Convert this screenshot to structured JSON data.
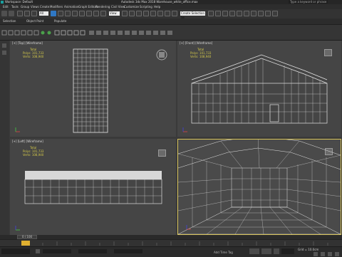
{
  "title": {
    "workspace": "Workspace: Default",
    "app_title": "Autodesk 3ds Max 2018    Warehouse_white_office.max",
    "search_placeholder": "Type a keyword or phrase"
  },
  "menu": [
    "Edit",
    "Tools",
    "Group",
    "Views",
    "Create",
    "Modifiers",
    "Animation",
    "Graph Editors",
    "Rendering",
    "Civil View",
    "Customize",
    "Scripting",
    "Help"
  ],
  "toolbar": {
    "selection_filter": "All",
    "view_dropdown": "View",
    "named_selection": "Create Selection Se"
  },
  "ribbon": {
    "tabs": [
      "Selection",
      "Object Paint",
      "Populate"
    ]
  },
  "viewports": {
    "top": {
      "label": "[+] [Top] [Wireframe]"
    },
    "front": {
      "label": "[+] [Front] [Wireframe]"
    },
    "left": {
      "label": "[+] [Left] [Wireframe]"
    },
    "stats": {
      "total": "Total",
      "polys_label": "Polys:",
      "polys": "101,733",
      "verts_label": "Verts:",
      "verts": "108,940"
    }
  },
  "timeline": {
    "frame_readout": "0 / 100"
  },
  "status": {
    "grid": "Grid = 10.0cm",
    "add_time_tag": "Add Time Tag"
  }
}
